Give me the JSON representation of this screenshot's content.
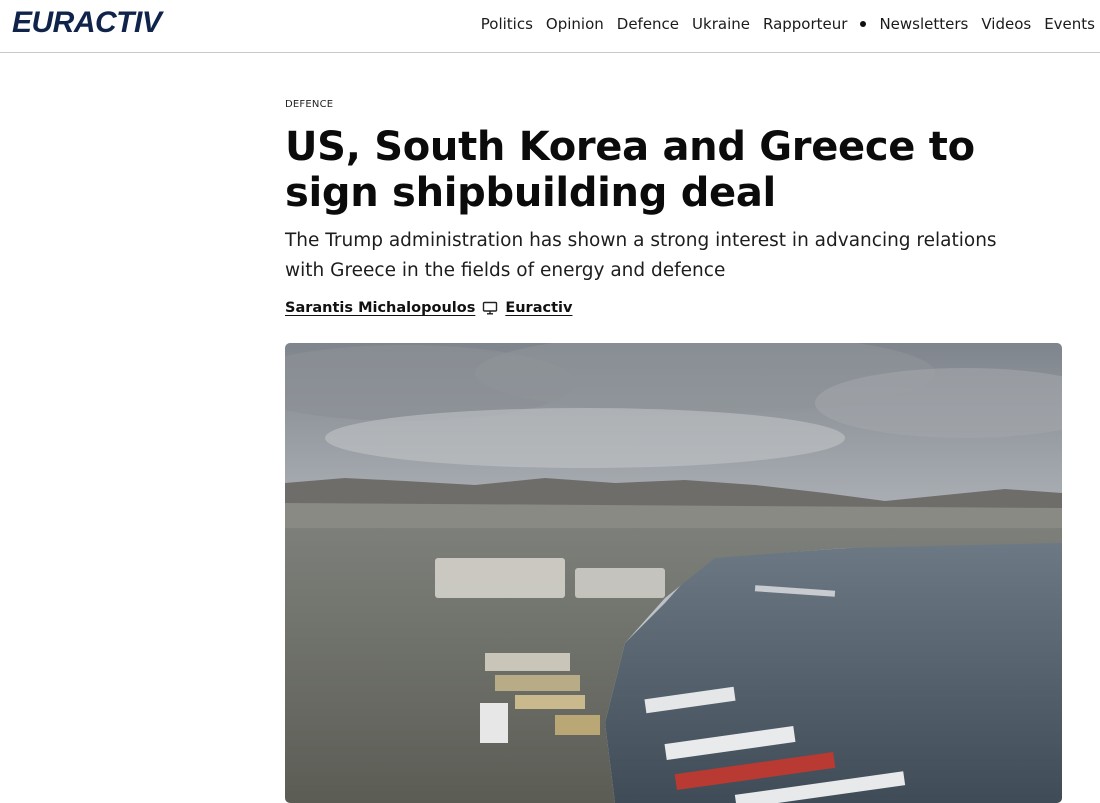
{
  "header": {
    "logo": "EURACTIV",
    "nav": [
      "Politics",
      "Opinion",
      "Defence",
      "Ukraine",
      "Rapporteur",
      "Newsletters",
      "Videos",
      "Events"
    ]
  },
  "article": {
    "category": "DEFENCE",
    "title": "US, South Korea and Greece to sign shipbuilding deal",
    "subtitle": "The Trump administration has shown a strong interest in advancing relations with Greece in the fields of energy and defence",
    "author": "Sarantis Michalopoulos",
    "publisher": "Euractiv",
    "publisher_icon": "monitor-icon",
    "image_icon": "aerial-shipyard-photo"
  },
  "colors": {
    "logo": "#10234a",
    "sea": "#4a5866",
    "sky": "#b9bcc0"
  }
}
